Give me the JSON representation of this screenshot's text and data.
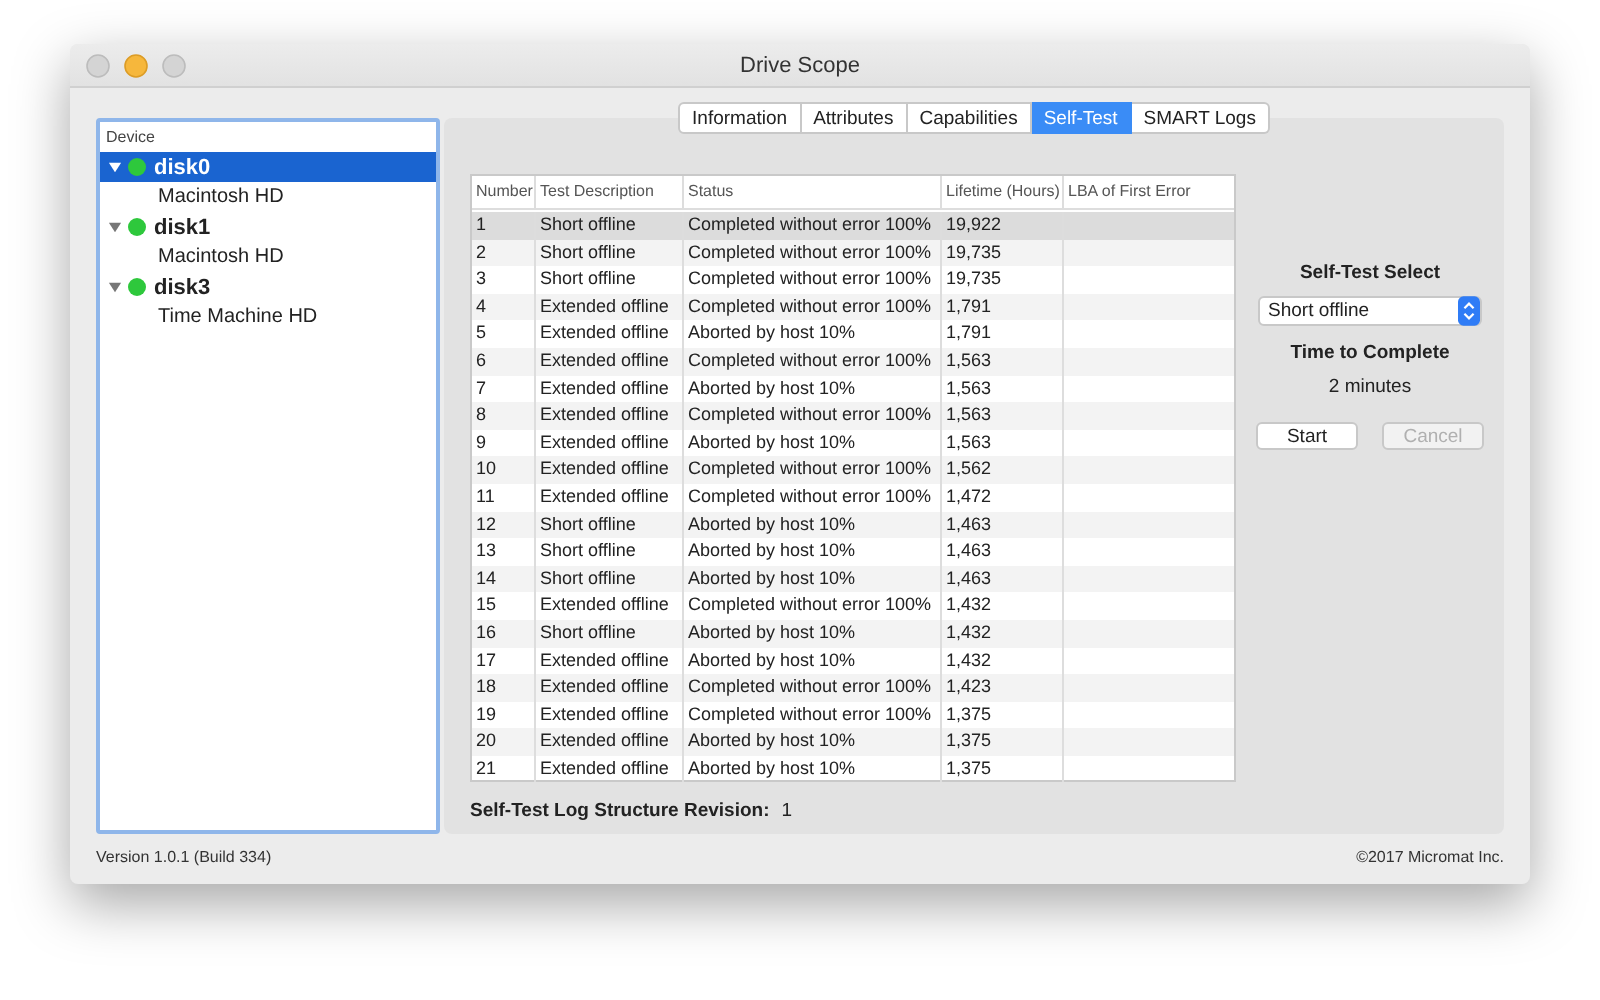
{
  "window": {
    "title": "Drive Scope"
  },
  "sidebar": {
    "header": "Device",
    "items": [
      {
        "name": "disk0",
        "color": "#2ec83c",
        "expanded": true,
        "selected": true,
        "children": [
          {
            "name": "Macintosh HD",
            "selected": false
          }
        ]
      },
      {
        "name": "disk1",
        "color": "#2ec83c",
        "expanded": true,
        "selected": false,
        "children": [
          {
            "name": "Macintosh HD",
            "selected": false
          }
        ]
      },
      {
        "name": "disk3",
        "color": "#2ec83c",
        "expanded": true,
        "selected": false,
        "children": [
          {
            "name": "Time Machine HD",
            "selected": false
          }
        ]
      }
    ]
  },
  "tabs": [
    {
      "label": "Information",
      "selected": false
    },
    {
      "label": "Attributes",
      "selected": false
    },
    {
      "label": "Capabilities",
      "selected": false
    },
    {
      "label": "Self-Test",
      "selected": true
    },
    {
      "label": "SMART Logs",
      "selected": false
    }
  ],
  "table": {
    "columns": [
      "Number",
      "Test Description",
      "Status",
      "Lifetime (Hours)",
      "LBA of First Error"
    ],
    "rows": [
      {
        "cells": [
          "1",
          "Short offline",
          "Completed without error 100%",
          "19,922",
          ""
        ],
        "selected": true
      },
      {
        "cells": [
          "2",
          "Short offline",
          "Completed without error 100%",
          "19,735",
          ""
        ],
        "selected": false
      },
      {
        "cells": [
          "3",
          "Short offline",
          "Completed without error 100%",
          "19,735",
          ""
        ],
        "selected": false
      },
      {
        "cells": [
          "4",
          "Extended offline",
          "Completed without error 100%",
          "1,791",
          ""
        ],
        "selected": false
      },
      {
        "cells": [
          "5",
          "Extended offline",
          "Aborted by host 10%",
          "1,791",
          ""
        ],
        "selected": false
      },
      {
        "cells": [
          "6",
          "Extended offline",
          "Completed without error 100%",
          "1,563",
          ""
        ],
        "selected": false
      },
      {
        "cells": [
          "7",
          "Extended offline",
          "Aborted by host 10%",
          "1,563",
          ""
        ],
        "selected": false
      },
      {
        "cells": [
          "8",
          "Extended offline",
          "Completed without error 100%",
          "1,563",
          ""
        ],
        "selected": false
      },
      {
        "cells": [
          "9",
          "Extended offline",
          "Aborted by host 10%",
          "1,563",
          ""
        ],
        "selected": false
      },
      {
        "cells": [
          "10",
          "Extended offline",
          "Completed without error 100%",
          "1,562",
          ""
        ],
        "selected": false
      },
      {
        "cells": [
          "11",
          "Extended offline",
          "Completed without error 100%",
          "1,472",
          ""
        ],
        "selected": false
      },
      {
        "cells": [
          "12",
          "Short offline",
          "Aborted by host 10%",
          "1,463",
          ""
        ],
        "selected": false
      },
      {
        "cells": [
          "13",
          "Short offline",
          "Aborted by host 10%",
          "1,463",
          ""
        ],
        "selected": false
      },
      {
        "cells": [
          "14",
          "Short offline",
          "Aborted by host 10%",
          "1,463",
          ""
        ],
        "selected": false
      },
      {
        "cells": [
          "15",
          "Extended offline",
          "Completed without error 100%",
          "1,432",
          ""
        ],
        "selected": false
      },
      {
        "cells": [
          "16",
          "Short offline",
          "Aborted by host 10%",
          "1,432",
          ""
        ],
        "selected": false
      },
      {
        "cells": [
          "17",
          "Extended offline",
          "Aborted by host 10%",
          "1,432",
          ""
        ],
        "selected": false
      },
      {
        "cells": [
          "18",
          "Extended offline",
          "Completed without error 100%",
          "1,423",
          ""
        ],
        "selected": false
      },
      {
        "cells": [
          "19",
          "Extended offline",
          "Completed without error 100%",
          "1,375",
          ""
        ],
        "selected": false
      },
      {
        "cells": [
          "20",
          "Extended offline",
          "Aborted by host 10%",
          "1,375",
          ""
        ],
        "selected": false
      },
      {
        "cells": [
          "21",
          "Extended offline",
          "Aborted by host 10%",
          "1,375",
          ""
        ],
        "selected": false
      }
    ]
  },
  "revision": {
    "label": "Self-Test Log Structure Revision:",
    "value": "1"
  },
  "self_test": {
    "select_label": "Self-Test Select",
    "select_value": "Short offline",
    "time_label": "Time to Complete",
    "time_value": "2 minutes",
    "buttons": [
      {
        "label": "Start",
        "disabled": false
      },
      {
        "label": "Cancel",
        "disabled": true
      }
    ]
  },
  "status_bar": {
    "version": "Version 1.0.1 (Build 334)",
    "copyright": "©2017 Micromat Inc."
  }
}
